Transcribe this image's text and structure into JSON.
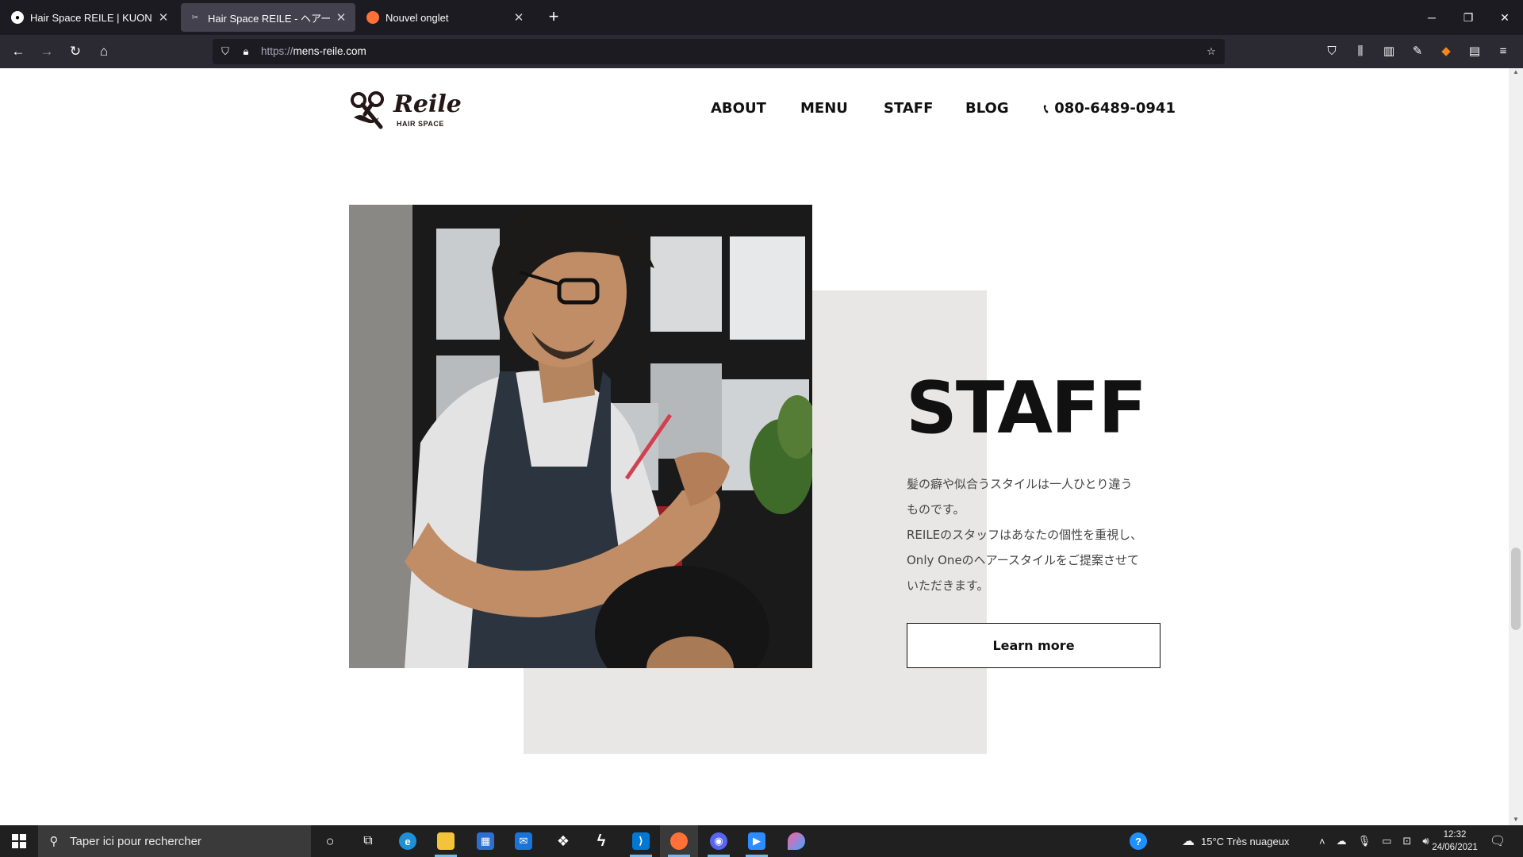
{
  "browser": {
    "tabs": [
      {
        "title": "Hair Space REILE | KUON YAGI P",
        "active": false
      },
      {
        "title": "Hair Space REILE - ヘアースペ",
        "active": true
      },
      {
        "title": "Nouvel onglet",
        "active": false
      }
    ],
    "url_scheme": "https://",
    "url_host": "mens-reile.com"
  },
  "site": {
    "logo_text": "Reile",
    "logo_sub": "HAIR SPACE",
    "nav": [
      "ABOUT",
      "MENU",
      "STAFF",
      "BLOG"
    ],
    "phone": "080-6489-0941"
  },
  "staff": {
    "title": "STAFF",
    "desc": [
      "髪の癖や似合うスタイルは一人ひとり違う",
      "ものです。",
      "REILEのスタッフはあなたの個性を重視し、",
      "Only Oneのヘアースタイルをご提案させて",
      "いただきます。"
    ],
    "button": "Learn more"
  },
  "taskbar": {
    "search_placeholder": "Taper ici pour rechercher",
    "weather": "15°C  Très nuageux",
    "time": "12:32",
    "date": "24/06/2021"
  },
  "colors": {
    "tabbar": "#1c1b22",
    "toolbar": "#2b2a33",
    "accent_gray": "#e8e7e5",
    "text_dark": "#111111"
  }
}
